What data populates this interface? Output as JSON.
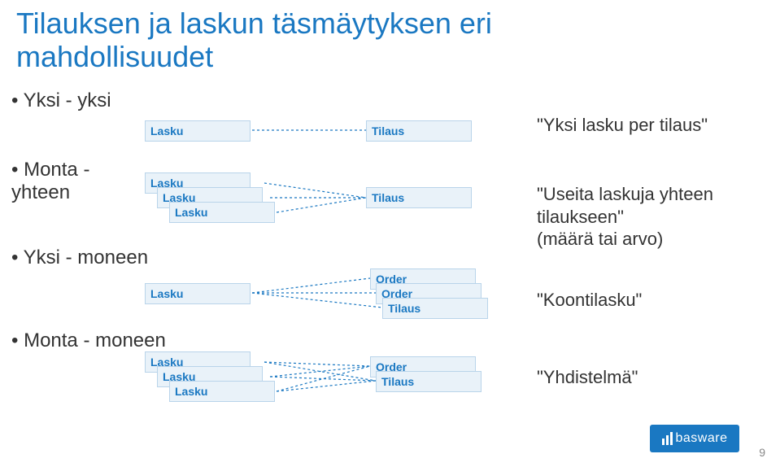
{
  "title_line1": "Tilauksen ja laskun täsmäytyksen eri",
  "title_line2": "mahdollisuudet",
  "bullets": {
    "b1": "Yksi - yksi",
    "b2": "Monta - yhteen",
    "b2a": "Monta -",
    "b2b": "yhteen",
    "b3": "Yksi - moneen",
    "b4": "Monta - moneen"
  },
  "labels": {
    "lasku": "Lasku",
    "tilaus": "Tilaus",
    "order": "Order"
  },
  "quotes": {
    "q1": "\"Yksi lasku per tilaus\"",
    "q2a": "\"Useita laskuja yhteen",
    "q2b": "tilaukseen\"",
    "q2c": "(määrä tai arvo)",
    "q3": "\"Koontilasku\"",
    "q4": "\"Yhdistelmä\""
  },
  "page": "9",
  "logo": "basware"
}
